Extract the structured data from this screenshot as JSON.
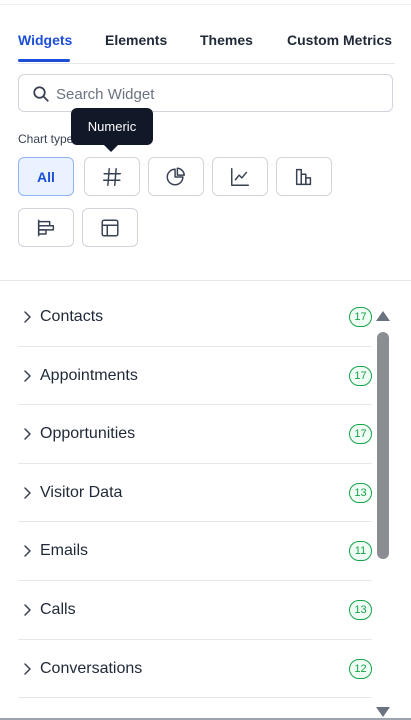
{
  "tabs": [
    {
      "label": "Widgets",
      "active": true
    },
    {
      "label": "Elements"
    },
    {
      "label": "Themes"
    },
    {
      "label": "Custom Metrics"
    }
  ],
  "search": {
    "placeholder": "Search Widget",
    "value": ""
  },
  "chart_type": {
    "label": "Chart type",
    "tooltip": "Numeric",
    "options": [
      {
        "label": "All",
        "icon": "all-text",
        "active": true
      },
      {
        "label": "Numeric",
        "icon": "hash-icon"
      },
      {
        "label": "Pie",
        "icon": "pie-chart-icon"
      },
      {
        "label": "Line",
        "icon": "line-chart-icon"
      },
      {
        "label": "Bar",
        "icon": "bar-chart-icon"
      },
      {
        "label": "Horizontal Bar",
        "icon": "horizontal-bar-chart-icon"
      },
      {
        "label": "Table",
        "icon": "table-icon"
      }
    ]
  },
  "categories": [
    {
      "label": "Contacts",
      "count": "17"
    },
    {
      "label": "Appointments",
      "count": "17"
    },
    {
      "label": "Opportunities",
      "count": "17"
    },
    {
      "label": "Visitor Data",
      "count": "13"
    },
    {
      "label": "Emails",
      "count": "11"
    },
    {
      "label": "Calls",
      "count": "13"
    },
    {
      "label": "Conversations",
      "count": "12"
    }
  ],
  "colors": {
    "accent": "#1d4ed8",
    "badge": "#16a34a",
    "tooltip_bg": "#111827"
  }
}
